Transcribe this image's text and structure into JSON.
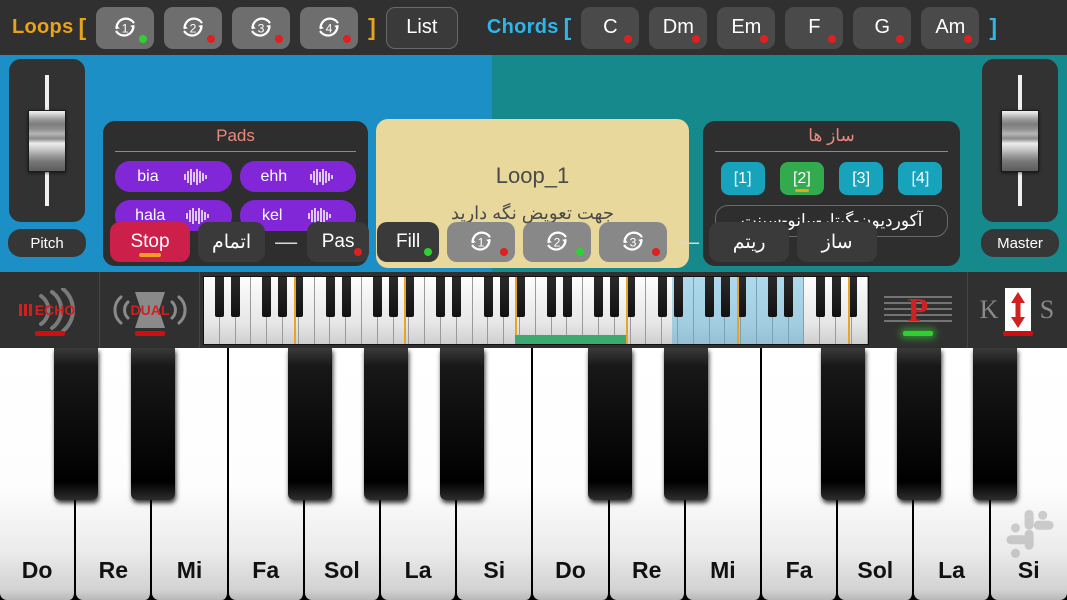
{
  "topbar": {
    "loops": {
      "label": "Loops",
      "bracket_open": "[",
      "bracket_close": "]",
      "buttons": [
        {
          "label": "1",
          "icon": "loop-arrow-icon",
          "status": "green"
        },
        {
          "label": "2",
          "icon": "loop-arrow-icon",
          "status": "red"
        },
        {
          "label": "3",
          "icon": "loop-arrow-icon",
          "status": "red"
        },
        {
          "label": "4",
          "icon": "loop-arrow-icon",
          "status": "red"
        }
      ],
      "list_label": "List"
    },
    "chords": {
      "label": "Chords",
      "bracket_open": "[",
      "bracket_close": "]",
      "buttons": [
        {
          "label": "C",
          "status": "red"
        },
        {
          "label": "Dm",
          "status": "red"
        },
        {
          "label": "Em",
          "status": "red"
        },
        {
          "label": "F",
          "status": "red"
        },
        {
          "label": "G",
          "status": "red"
        },
        {
          "label": "Am",
          "status": "red"
        }
      ]
    }
  },
  "pitch_fader": {
    "label": "Pitch"
  },
  "master_fader": {
    "label": "Master"
  },
  "pads": {
    "title": "Pads",
    "items": [
      {
        "label": "bia",
        "icon": "waveform-icon"
      },
      {
        "label": "ehh",
        "icon": "waveform-icon"
      },
      {
        "label": "hala",
        "icon": "waveform-icon"
      },
      {
        "label": "kel",
        "icon": "waveform-icon"
      }
    ]
  },
  "loop_display": {
    "name": "Loop_1",
    "hint": "جهت تعویض نگه دارید"
  },
  "instruments": {
    "title": "ساز ها",
    "slots": [
      {
        "label": "[1]",
        "active": false
      },
      {
        "label": "[2]",
        "active": true
      },
      {
        "label": "[3]",
        "active": false
      },
      {
        "label": "[4]",
        "active": false
      }
    ],
    "field_value": "آکوردیون-گیتار-پیانو-سینت"
  },
  "transport": {
    "stop": "Stop",
    "end": "اتمام",
    "separator": "—",
    "pas": {
      "label": "Pas",
      "status": "red"
    },
    "fill": {
      "label": "Fill",
      "status": "green"
    },
    "rhythm_loops": [
      {
        "label": "1",
        "icon": "loop-arrow-icon",
        "status": "red"
      },
      {
        "label": "2",
        "icon": "loop-arrow-icon",
        "status": "green"
      },
      {
        "label": "3",
        "icon": "loop-arrow-icon",
        "status": "red"
      }
    ],
    "rhythm": "ریتم",
    "instrument": "ساز"
  },
  "strip": {
    "effects": [
      {
        "name": "echo-effect-icon",
        "label": "ECHO",
        "status": "red"
      },
      {
        "name": "dual-effect-icon",
        "label": "DUAL",
        "status": "red"
      }
    ],
    "right_tools": [
      {
        "name": "sheet-music-p-icon",
        "label": "P",
        "status": "green"
      },
      {
        "name": "keyboard-split-icon",
        "label_left": "K",
        "label_right": "S",
        "status": "red"
      }
    ]
  },
  "keyboard": {
    "white_key_labels": [
      "Do",
      "Re",
      "Mi",
      "Fa",
      "Sol",
      "La",
      "Si",
      "Do",
      "Re",
      "Mi",
      "Fa",
      "Sol",
      "La",
      "Si"
    ],
    "black_key_pattern": [
      1,
      1,
      0,
      1,
      1,
      1,
      0
    ],
    "octaves": 2,
    "watermark": "app-logo-watermark"
  },
  "colors": {
    "blue_panel": "#1b8fc6",
    "teal_panel": "#16898c",
    "pad_purple": "#8127d8",
    "loop_display": "#e8d89c",
    "stop_red": "#cc1f4a",
    "instrument_blue": "#18a3bd",
    "instrument_active_green": "#31ab4d",
    "loops_label": "#e8a317",
    "chords_label": "#2eb5ea",
    "status_green": "#2fd02f",
    "status_red": "#e02020"
  }
}
